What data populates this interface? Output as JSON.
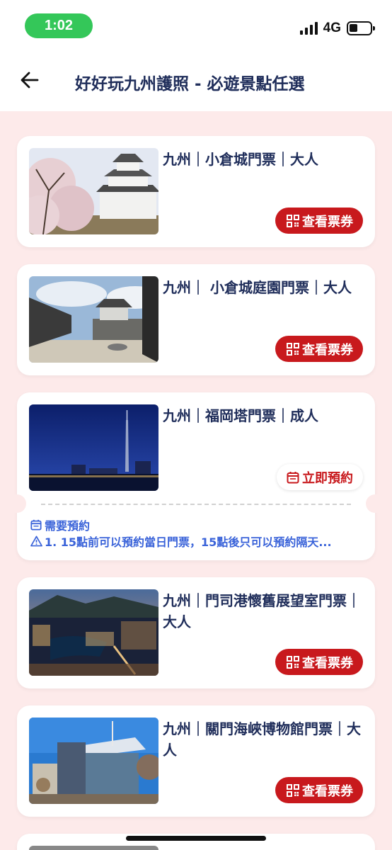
{
  "status_bar": {
    "time": "1:02",
    "network": "4G"
  },
  "header": {
    "title": "好好玩九州護照 - 必遊景點任選"
  },
  "cards": [
    {
      "title": "九州｜小倉城門票｜大人",
      "action": "查看票券",
      "action_type": "ticket"
    },
    {
      "title": "九州｜ 小倉城庭園門票｜大人",
      "action": "查看票券",
      "action_type": "ticket"
    },
    {
      "title": "九州｜福岡塔門票｜成人",
      "action": "立即預約",
      "action_type": "reserve",
      "reservation_label": "需要預約",
      "reservation_note": "1. 15點前可以預約當日門票，15點後只可以預約隔天..."
    },
    {
      "title": "九州｜門司港懷舊展望室門票｜大人",
      "action": "查看票券",
      "action_type": "ticket"
    },
    {
      "title": "九州｜關門海峽博物館門票｜大人",
      "action": "查看票券",
      "action_type": "ticket"
    }
  ],
  "colors": {
    "accent_red": "#c8191d",
    "title_navy": "#1f2d5a",
    "info_blue": "#3a63d9",
    "page_bg": "#fdeaea",
    "status_green": "#34c759"
  }
}
